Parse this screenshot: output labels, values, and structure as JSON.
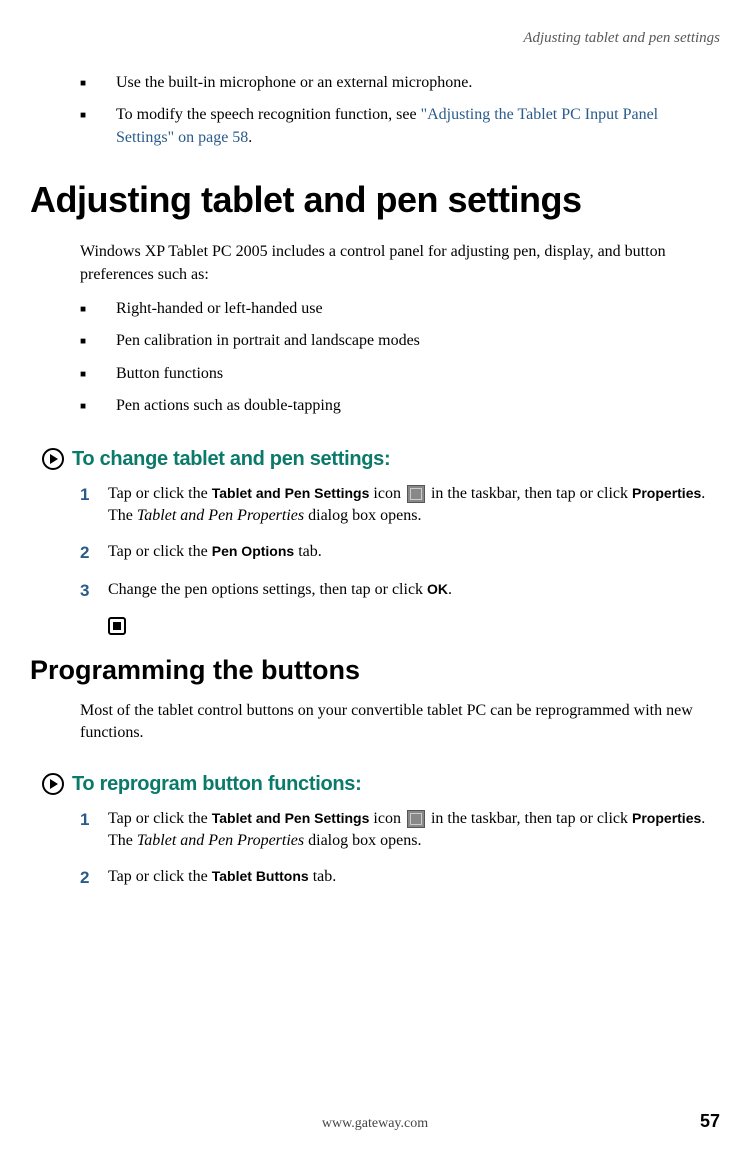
{
  "running_head": "Adjusting tablet and pen settings",
  "intro_bullets": [
    {
      "prefix": "■",
      "text": "Use the built-in microphone or an external microphone."
    },
    {
      "prefix": "■",
      "text": "To modify the speech recognition function, see ",
      "link": "\"Adjusting the Tablet PC Input Panel Settings\" on page 58",
      "suffix": "."
    }
  ],
  "heading1": "Adjusting tablet and pen settings",
  "para1": "Windows XP Tablet PC 2005 includes a control panel for adjusting pen, display, and button preferences such as:",
  "pref_bullets": [
    {
      "prefix": "■",
      "text": "Right-handed or left-handed use"
    },
    {
      "prefix": "■",
      "text": "Pen calibration in portrait and landscape modes"
    },
    {
      "prefix": "■",
      "text": "Button functions"
    },
    {
      "prefix": "■",
      "text": "Pen actions such as double-tapping"
    }
  ],
  "proc1_title": "To change tablet and pen settings:",
  "proc1_steps": {
    "s1": {
      "num": "1",
      "a": "Tap or click the ",
      "b_bold": "Tablet and Pen Settings",
      "c": " icon ",
      "d": " in the taskbar, then tap or click ",
      "e_bold": "Properties",
      "f": ". The ",
      "g_ital": "Tablet and Pen Properties",
      "h": " dialog box opens."
    },
    "s2": {
      "num": "2",
      "a": "Tap or click the ",
      "b_bold": "Pen Options",
      "c": " tab."
    },
    "s3": {
      "num": "3",
      "a": "Change the pen options settings, then tap or click ",
      "b_bold": "OK",
      "c": "."
    }
  },
  "heading2": "Programming the buttons",
  "para2": "Most of the tablet control buttons on your convertible tablet PC can be reprogrammed with new functions.",
  "proc2_title": "To reprogram button functions:",
  "proc2_steps": {
    "s1": {
      "num": "1",
      "a": "Tap or click the ",
      "b_bold": "Tablet and Pen Settings",
      "c": " icon ",
      "d": " in the taskbar, then tap or click ",
      "e_bold": "Properties",
      "f": ". The ",
      "g_ital": "Tablet and Pen Properties",
      "h": " dialog box opens."
    },
    "s2": {
      "num": "2",
      "a": "Tap or click the ",
      "b_bold": "Tablet Buttons",
      "c": " tab."
    }
  },
  "footer": {
    "url": "www.gateway.com",
    "page": "57"
  }
}
